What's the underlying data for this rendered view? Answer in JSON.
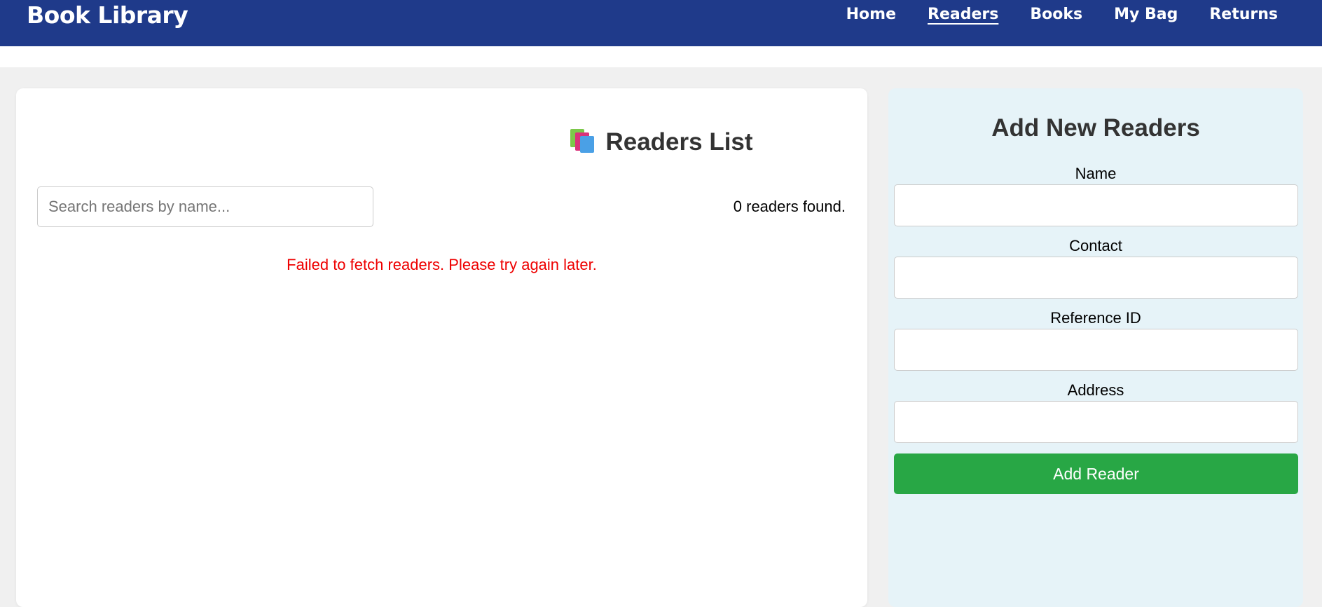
{
  "header": {
    "brand": "Book Library",
    "nav": [
      {
        "label": "Home",
        "active": false
      },
      {
        "label": "Readers",
        "active": true
      },
      {
        "label": "Books",
        "active": false
      },
      {
        "label": "My Bag",
        "active": false
      },
      {
        "label": "Returns",
        "active": false
      }
    ]
  },
  "readers_panel": {
    "title": "Readers List",
    "icon": "books-icon",
    "search": {
      "placeholder": "Search readers by name...",
      "value": ""
    },
    "count_text": "0 readers found.",
    "error_text": "Failed to fetch readers. Please try again later.",
    "error_color": "#ee0000"
  },
  "add_panel": {
    "title": "Add New Readers",
    "fields": [
      {
        "label": "Name",
        "value": ""
      },
      {
        "label": "Contact",
        "value": ""
      },
      {
        "label": "Reference ID",
        "value": ""
      },
      {
        "label": "Address",
        "value": ""
      }
    ],
    "submit_label": "Add Reader",
    "submit_color": "#28a745"
  },
  "colors": {
    "navbar": "#1f3a8a",
    "page_bg": "#f0f0f0",
    "side_panel_bg": "#e6f3f8"
  }
}
